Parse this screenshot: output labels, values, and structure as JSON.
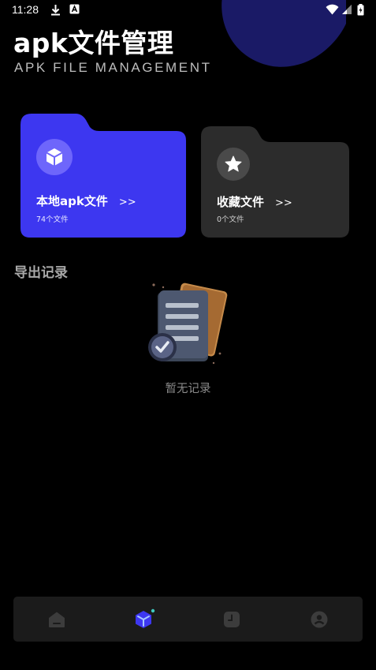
{
  "status_bar": {
    "time": "11:28"
  },
  "header": {
    "title": "apk文件管理",
    "subtitle": "APK FILE MANAGEMENT"
  },
  "cards": {
    "local": {
      "title": "本地apk文件",
      "arrow": ">>",
      "count": "74个文件",
      "color": "#3d37f0",
      "icon": "cube-icon"
    },
    "favorites": {
      "title": "收藏文件",
      "arrow": ">>",
      "count": "0个文件",
      "color": "#2c2c2c",
      "icon": "star-icon"
    }
  },
  "export_section": {
    "title": "导出记录",
    "empty_text": "暂无记录"
  },
  "bottom_nav": {
    "items": [
      {
        "icon": "home-icon",
        "active": false
      },
      {
        "icon": "cube-icon",
        "active": true
      },
      {
        "icon": "clock-icon",
        "active": false
      },
      {
        "icon": "profile-icon",
        "active": false
      }
    ]
  },
  "colors": {
    "background": "#000000",
    "accent": "#3d37f0",
    "blob": "#1a1a66",
    "card_dark": "#2c2c2c",
    "nav_bar": "#1b1b1b"
  }
}
